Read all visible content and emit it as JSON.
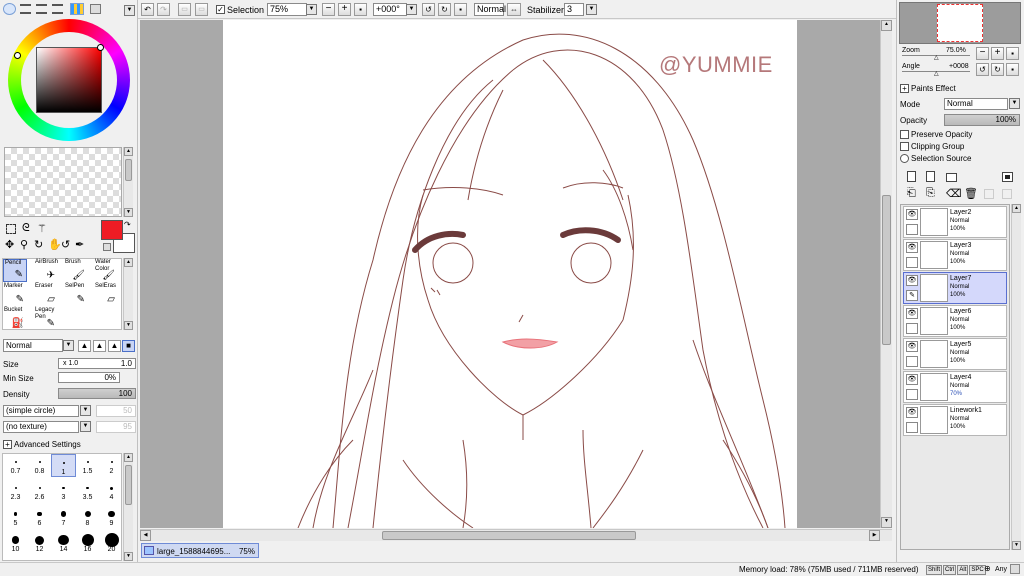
{
  "toolbar": {
    "selection_label": "Selection",
    "zoom_value": "75%",
    "angle_value": "+000°",
    "blend_value": "Normal",
    "stabilizer_label": "Stabilizer",
    "stabilizer_value": "3"
  },
  "left": {
    "primary_color": "#ee1c24",
    "tools": [
      {
        "label": "Pencil",
        "glyph": "✎"
      },
      {
        "label": "AirBrush",
        "glyph": "✈"
      },
      {
        "label": "Brush",
        "glyph": "🖌"
      },
      {
        "label": "Water Color",
        "glyph": "🖌"
      },
      {
        "label": "Marker",
        "glyph": "✎"
      },
      {
        "label": "Eraser",
        "glyph": "▱"
      },
      {
        "label": "SelPen",
        "glyph": "✎"
      },
      {
        "label": "SelEras",
        "glyph": "▱"
      },
      {
        "label": "Bucket",
        "glyph": "⛽"
      },
      {
        "label": "Legacy Pen",
        "glyph": "✎"
      }
    ],
    "blend_mode": "Normal",
    "size_label": "Size",
    "size_mult": "x 1.0",
    "size_value": "1.0",
    "min_size_label": "Min Size",
    "min_size_value": "0%",
    "density_label": "Density",
    "density_value": "100",
    "shape_value": "(simple circle)",
    "shape_num": "50",
    "texture_value": "(no texture)",
    "texture_num": "95",
    "advanced_label": "Advanced Settings",
    "brush_sizes": [
      "0.7",
      "0.8",
      "1",
      "1.5",
      "2",
      "2.3",
      "2.6",
      "3",
      "3.5",
      "4",
      "5",
      "6",
      "7",
      "8",
      "9",
      "10",
      "12",
      "14",
      "16",
      "20"
    ],
    "selected_size": "1"
  },
  "canvas": {
    "watermark": "@YUMMIE",
    "tab_label": "large_1588844695...",
    "tab_zoom": "75%"
  },
  "right": {
    "zoom_label": "Zoom",
    "zoom_value": "75.0%",
    "angle_label": "Angle",
    "angle_value": "+0008",
    "paints_effect_label": "Paints Effect",
    "mode_label": "Mode",
    "mode_value": "Normal",
    "opacity_label": "Opacity",
    "opacity_value": "100%",
    "preserve_opacity": "Preserve Opacity",
    "clipping_group": "Clipping Group",
    "selection_source": "Selection Source",
    "layers": [
      {
        "name": "Layer2",
        "mode": "Normal",
        "opacity": "100%",
        "selected": false
      },
      {
        "name": "Layer3",
        "mode": "Normal",
        "opacity": "100%",
        "selected": false
      },
      {
        "name": "Layer7",
        "mode": "Normal",
        "opacity": "100%",
        "selected": true
      },
      {
        "name": "Layer6",
        "mode": "Normal",
        "opacity": "100%",
        "selected": false
      },
      {
        "name": "Layer5",
        "mode": "Normal",
        "opacity": "100%",
        "selected": false
      },
      {
        "name": "Layer4",
        "mode": "Normal",
        "opacity": "70%",
        "selected": false
      },
      {
        "name": "Linework1",
        "mode": "Normal",
        "opacity": "100%",
        "selected": false
      }
    ]
  },
  "status": {
    "memory": "Memory load: 78% (75MB used / 711MB reserved)",
    "keys": [
      "Shift",
      "Ctrl",
      "Alt",
      "SPC"
    ],
    "any_label": "Any"
  }
}
